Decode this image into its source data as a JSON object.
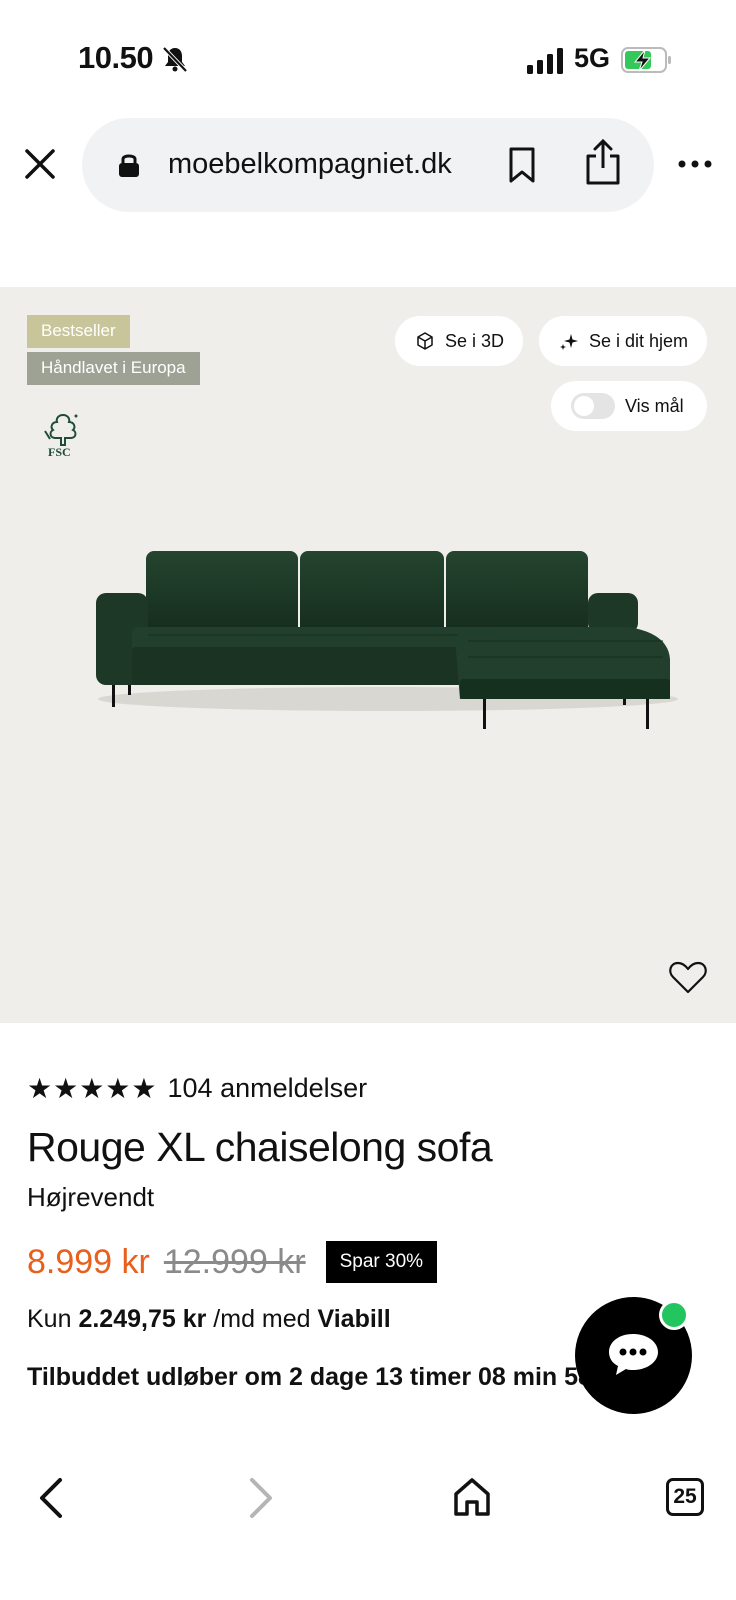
{
  "status_bar": {
    "time": "10.50",
    "network": "5G",
    "icons": [
      "bell-slash-icon",
      "signal-icon",
      "battery-charging-icon"
    ]
  },
  "browser": {
    "url": "moebelkompagniet.dk",
    "icons": [
      "close-icon",
      "lock-icon",
      "bookmark-icon",
      "share-icon",
      "more-icon"
    ]
  },
  "product_stage": {
    "badges": [
      "Bestseller",
      "Håndlavet i Europa"
    ],
    "fsc_label": "FSC",
    "view_3d_label": "Se i 3D",
    "view_home_label": "Se i dit hjem",
    "show_measure_label": "Vis mål",
    "colors": {
      "background": "#efeeeb",
      "sofa": "#1f3b2a"
    }
  },
  "product": {
    "stars": "★★★★★",
    "rating_value": 5,
    "reviews": "104 anmeldelser",
    "title": "Rouge XL chaiselong sofa",
    "variant": "Højrevendt",
    "price_now": "8.999 kr",
    "price_old": "12.999 kr",
    "save_badge": "Spar 30%",
    "finance_prefix": "Kun",
    "finance_amount": "2.249,75 kr",
    "finance_middle": "/md med",
    "finance_provider": "Viabill",
    "offer_text": "Tilbuddet udløber om 2 dage 13 timer 08 min 58 sek",
    "colors": {
      "price": "#e8601c",
      "badge": "#000000"
    }
  },
  "chat": {
    "status_color": "#22c55e"
  },
  "toolbar": {
    "tab_count": "25"
  }
}
